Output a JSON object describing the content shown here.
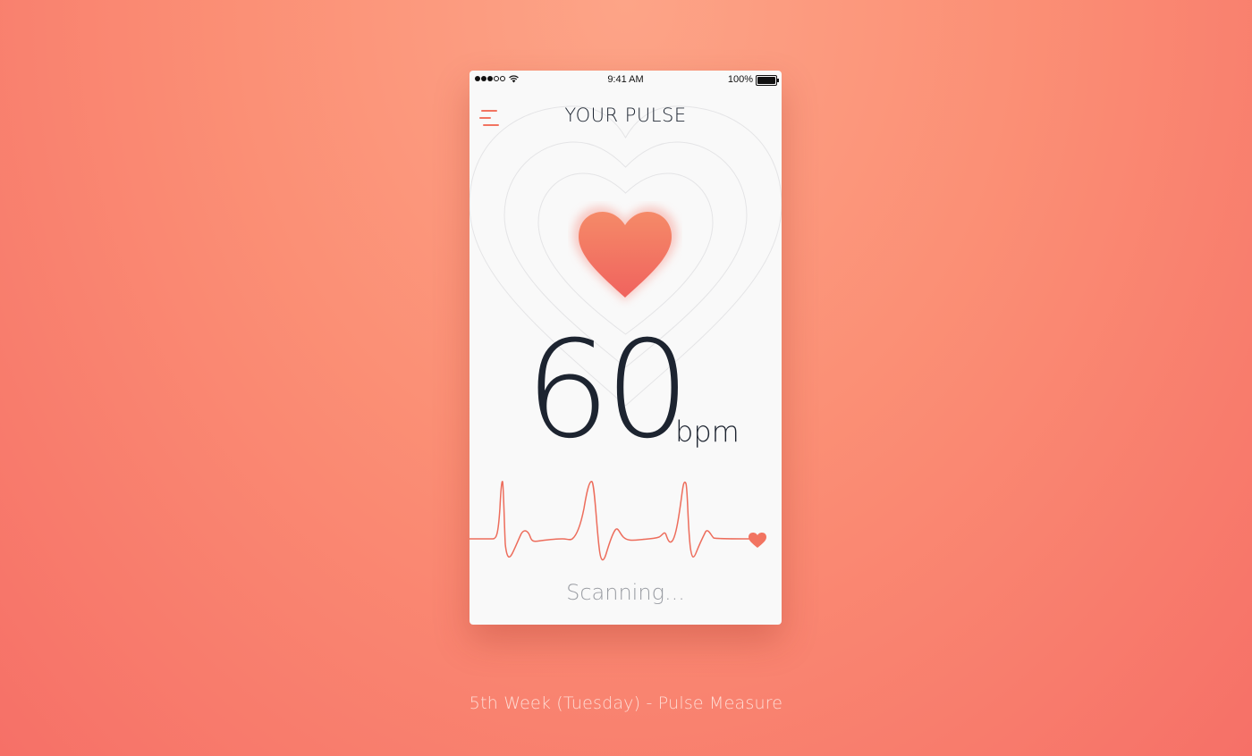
{
  "status_bar": {
    "time": "9:41 AM",
    "battery_percent": "100%",
    "signal_bars": 3,
    "signal_total": 5
  },
  "header": {
    "title": "YOUR PULSE",
    "menu_icon": "hamburger-menu-icon"
  },
  "pulse": {
    "value": "60",
    "unit": "bpm",
    "status": "Scanning..."
  },
  "caption": "5th Week (Tuesday) - Pulse Measure",
  "colors": {
    "accent": "#f27461",
    "heart_top": "#f58a68",
    "heart_bottom": "#f0635e",
    "text_dark": "#1d2430",
    "text_muted": "#9a9da3",
    "card_bg": "#f9f9f9"
  }
}
